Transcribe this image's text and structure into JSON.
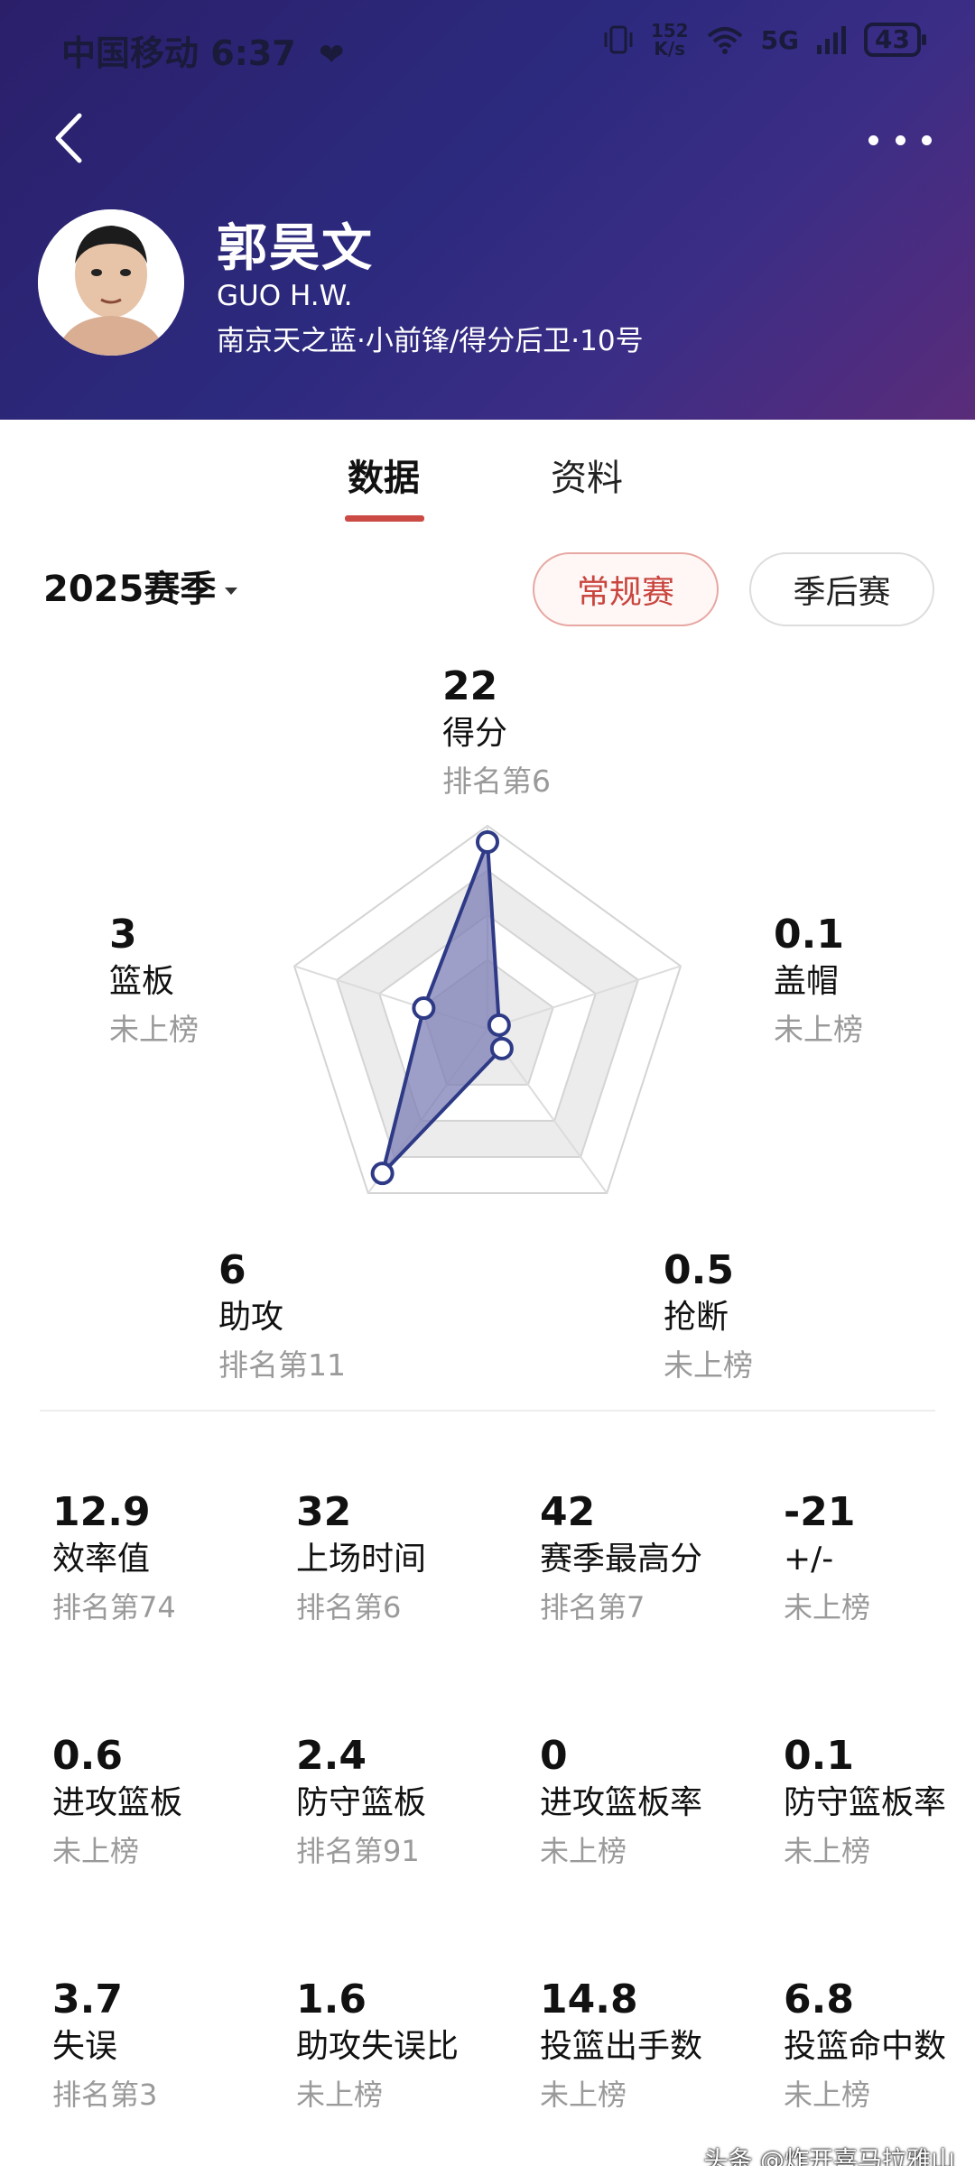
{
  "status_bar": {
    "carrier_time": "中国移动 6:37",
    "net_speed_value": "152",
    "net_speed_unit": "K/s",
    "network_type": "5G",
    "battery": "43"
  },
  "player": {
    "name_cn": "郭昊文",
    "name_en": "GUO H.W.",
    "team_info": "南京天之蓝·小前锋/得分后卫·10号"
  },
  "tabs": [
    {
      "label": "数据",
      "active": true
    },
    {
      "label": "资料",
      "active": false
    }
  ],
  "season": {
    "label": "2025赛季",
    "filters": [
      {
        "label": "常规赛",
        "active": true
      },
      {
        "label": "季后赛",
        "active": false
      }
    ]
  },
  "chart_data": {
    "type": "radar",
    "axes": [
      "得分",
      "盖帽",
      "抢断",
      "助攻",
      "篮板"
    ],
    "values": [
      22,
      0.1,
      0.5,
      6,
      3
    ],
    "ranks": [
      "排名第6",
      "未上榜",
      "未上榜",
      "排名第11",
      "未上榜"
    ],
    "normalized": [
      0.92,
      0.06,
      0.12,
      0.88,
      0.33
    ],
    "colors": {
      "fill": "#7d7fb6",
      "stroke": "#2e3a86",
      "grid": "#e8e8e8"
    }
  },
  "stats": [
    {
      "value": "12.9",
      "label": "效率值",
      "rank": "排名第74"
    },
    {
      "value": "32",
      "label": "上场时间",
      "rank": "排名第6"
    },
    {
      "value": "42",
      "label": "赛季最高分",
      "rank": "排名第7"
    },
    {
      "value": "-21",
      "label": "+/-",
      "rank": "未上榜"
    },
    {
      "value": "0.6",
      "label": "进攻篮板",
      "rank": "未上榜"
    },
    {
      "value": "2.4",
      "label": "防守篮板",
      "rank": "排名第91"
    },
    {
      "value": "0",
      "label": "进攻篮板率",
      "rank": "未上榜"
    },
    {
      "value": "0.1",
      "label": "防守篮板率",
      "rank": "未上榜"
    },
    {
      "value": "3.7",
      "label": "失误",
      "rank": "排名第3"
    },
    {
      "value": "1.6",
      "label": "助攻失误比",
      "rank": "未上榜"
    },
    {
      "value": "14.8",
      "label": "投篮出手数",
      "rank": "未上榜"
    },
    {
      "value": "6.8",
      "label": "投篮命中数",
      "rank": "未上榜"
    }
  ],
  "watermark": "头条 @炸开喜马拉雅山",
  "icons": [
    "back-icon",
    "more-icon",
    "wifi-icon",
    "signal-icon",
    "battery-icon",
    "vibrate-icon",
    "caret-down-icon"
  ]
}
